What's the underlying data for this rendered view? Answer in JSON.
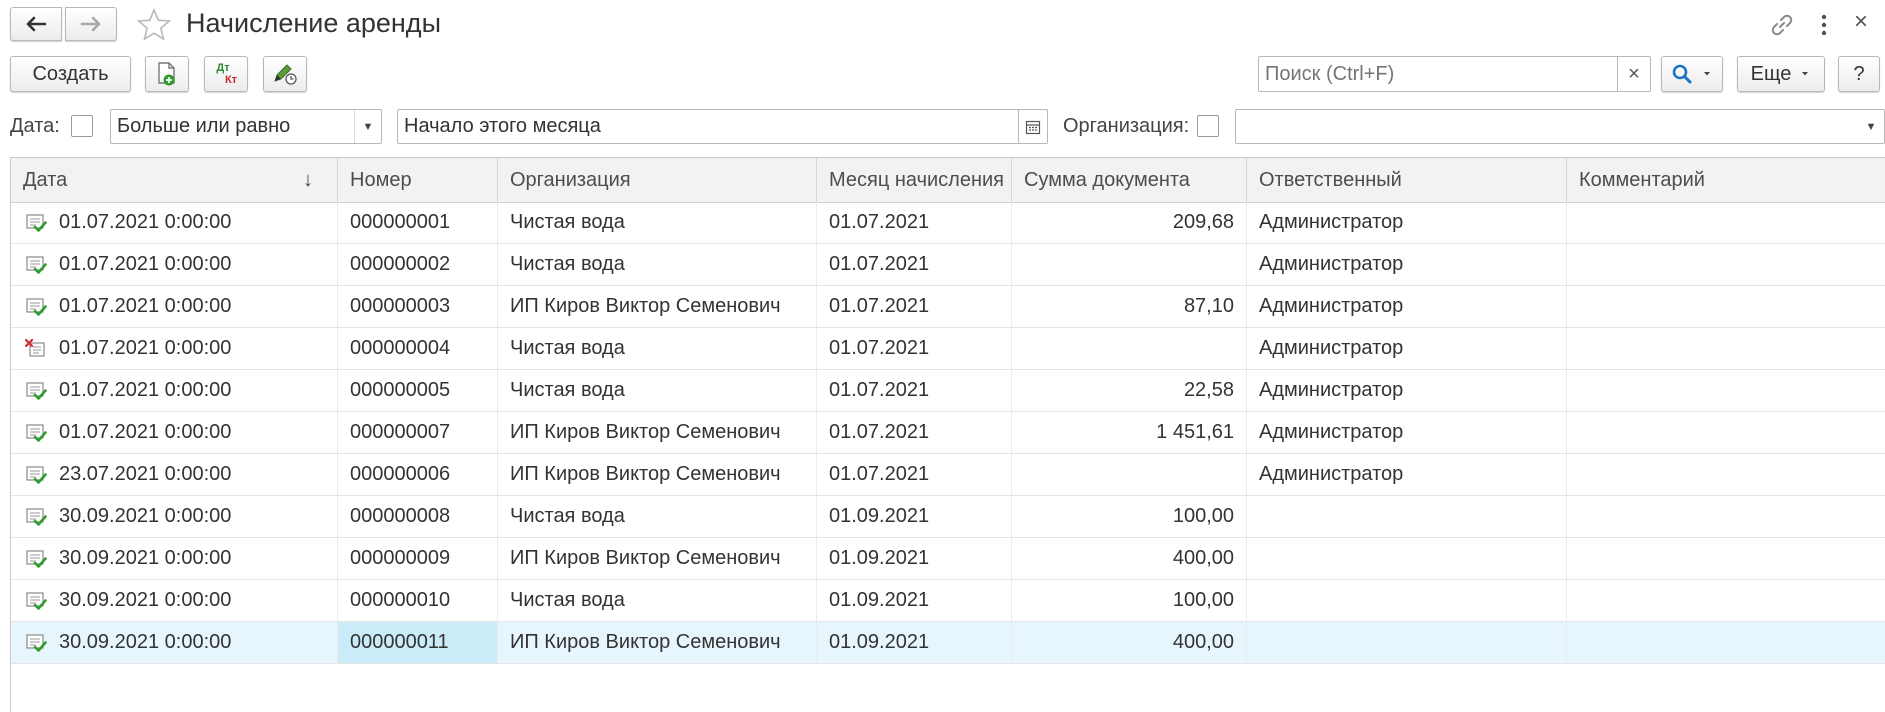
{
  "window": {
    "title": "Начисление аренды",
    "back_icon": "arrow-left-icon",
    "forward_icon": "arrow-right-icon",
    "favorite_icon": "star-icon",
    "link_icon": "link-icon",
    "more_icon": "vertical-dots-icon",
    "close_icon": "close-icon",
    "close_glyph": "×"
  },
  "toolbar": {
    "create_label": "Создать",
    "copy_icon": "new-document-copy-icon",
    "dtkt_top": "Дт",
    "dtkt_bottom": "Кт",
    "edit_icon": "edit-history-icon",
    "search_placeholder": "Поиск (Ctrl+F)",
    "search_value": "",
    "search_clear": "×",
    "search_icon": "search-icon",
    "more_label": "Еще",
    "help_label": "?"
  },
  "filters": {
    "date_label": "Дата:",
    "date_condition": "Больше или равно",
    "date_value": "Начало этого месяца",
    "calendar_icon": "calendar-icon",
    "org_label": "Организация:",
    "org_value": ""
  },
  "table": {
    "columns": {
      "date": "Дата",
      "sort_arrow": "↓",
      "number": "Номер",
      "org": "Организация",
      "month": "Месяц начисления",
      "sum": "Сумма документа",
      "responsible": "Ответственный",
      "comment": "Комментарий"
    },
    "rows": [
      {
        "status": "posted",
        "date": "01.07.2021 0:00:00",
        "number": "000000001",
        "org": "Чистая вода",
        "month": "01.07.2021",
        "sum": "209,68",
        "responsible": "Администратор",
        "comment": ""
      },
      {
        "status": "posted",
        "date": "01.07.2021 0:00:00",
        "number": "000000002",
        "org": "Чистая вода",
        "month": "01.07.2021",
        "sum": "",
        "responsible": "Администратор",
        "comment": ""
      },
      {
        "status": "posted",
        "date": "01.07.2021 0:00:00",
        "number": "000000003",
        "org": "ИП Киров Виктор Семенович",
        "month": "01.07.2021",
        "sum": "87,10",
        "responsible": "Администратор",
        "comment": ""
      },
      {
        "status": "deleted",
        "date": "01.07.2021 0:00:00",
        "number": "000000004",
        "org": "Чистая вода",
        "month": "01.07.2021",
        "sum": "",
        "responsible": "Администратор",
        "comment": ""
      },
      {
        "status": "posted",
        "date": "01.07.2021 0:00:00",
        "number": "000000005",
        "org": "Чистая вода",
        "month": "01.07.2021",
        "sum": "22,58",
        "responsible": "Администратор",
        "comment": ""
      },
      {
        "status": "posted",
        "date": "01.07.2021 0:00:00",
        "number": "000000007",
        "org": "ИП Киров Виктор Семенович",
        "month": "01.07.2021",
        "sum": "1 451,61",
        "responsible": "Администратор",
        "comment": ""
      },
      {
        "status": "posted",
        "date": "23.07.2021 0:00:00",
        "number": "000000006",
        "org": "ИП Киров Виктор Семенович",
        "month": "01.07.2021",
        "sum": "",
        "responsible": "Администратор",
        "comment": ""
      },
      {
        "status": "posted",
        "date": "30.09.2021 0:00:00",
        "number": "000000008",
        "org": "Чистая вода",
        "month": "01.09.2021",
        "sum": "100,00",
        "responsible": "",
        "comment": ""
      },
      {
        "status": "posted",
        "date": "30.09.2021 0:00:00",
        "number": "000000009",
        "org": "ИП Киров Виктор Семенович",
        "month": "01.09.2021",
        "sum": "400,00",
        "responsible": "",
        "comment": ""
      },
      {
        "status": "posted",
        "date": "30.09.2021 0:00:00",
        "number": "000000010",
        "org": "Чистая вода",
        "month": "01.09.2021",
        "sum": "100,00",
        "responsible": "",
        "comment": ""
      },
      {
        "status": "posted",
        "date": "30.09.2021 0:00:00",
        "number": "000000011",
        "org": "ИП Киров Виктор Семенович",
        "month": "01.09.2021",
        "sum": "400,00",
        "responsible": "",
        "comment": "",
        "selected": true
      }
    ]
  },
  "colors": {
    "accent": "#1a73c9",
    "selected_row": "#e6f6fc",
    "selected_cell": "#c9ecf8",
    "posted_check": "#2e9d2e",
    "deleted_mark": "#d22d2d"
  }
}
